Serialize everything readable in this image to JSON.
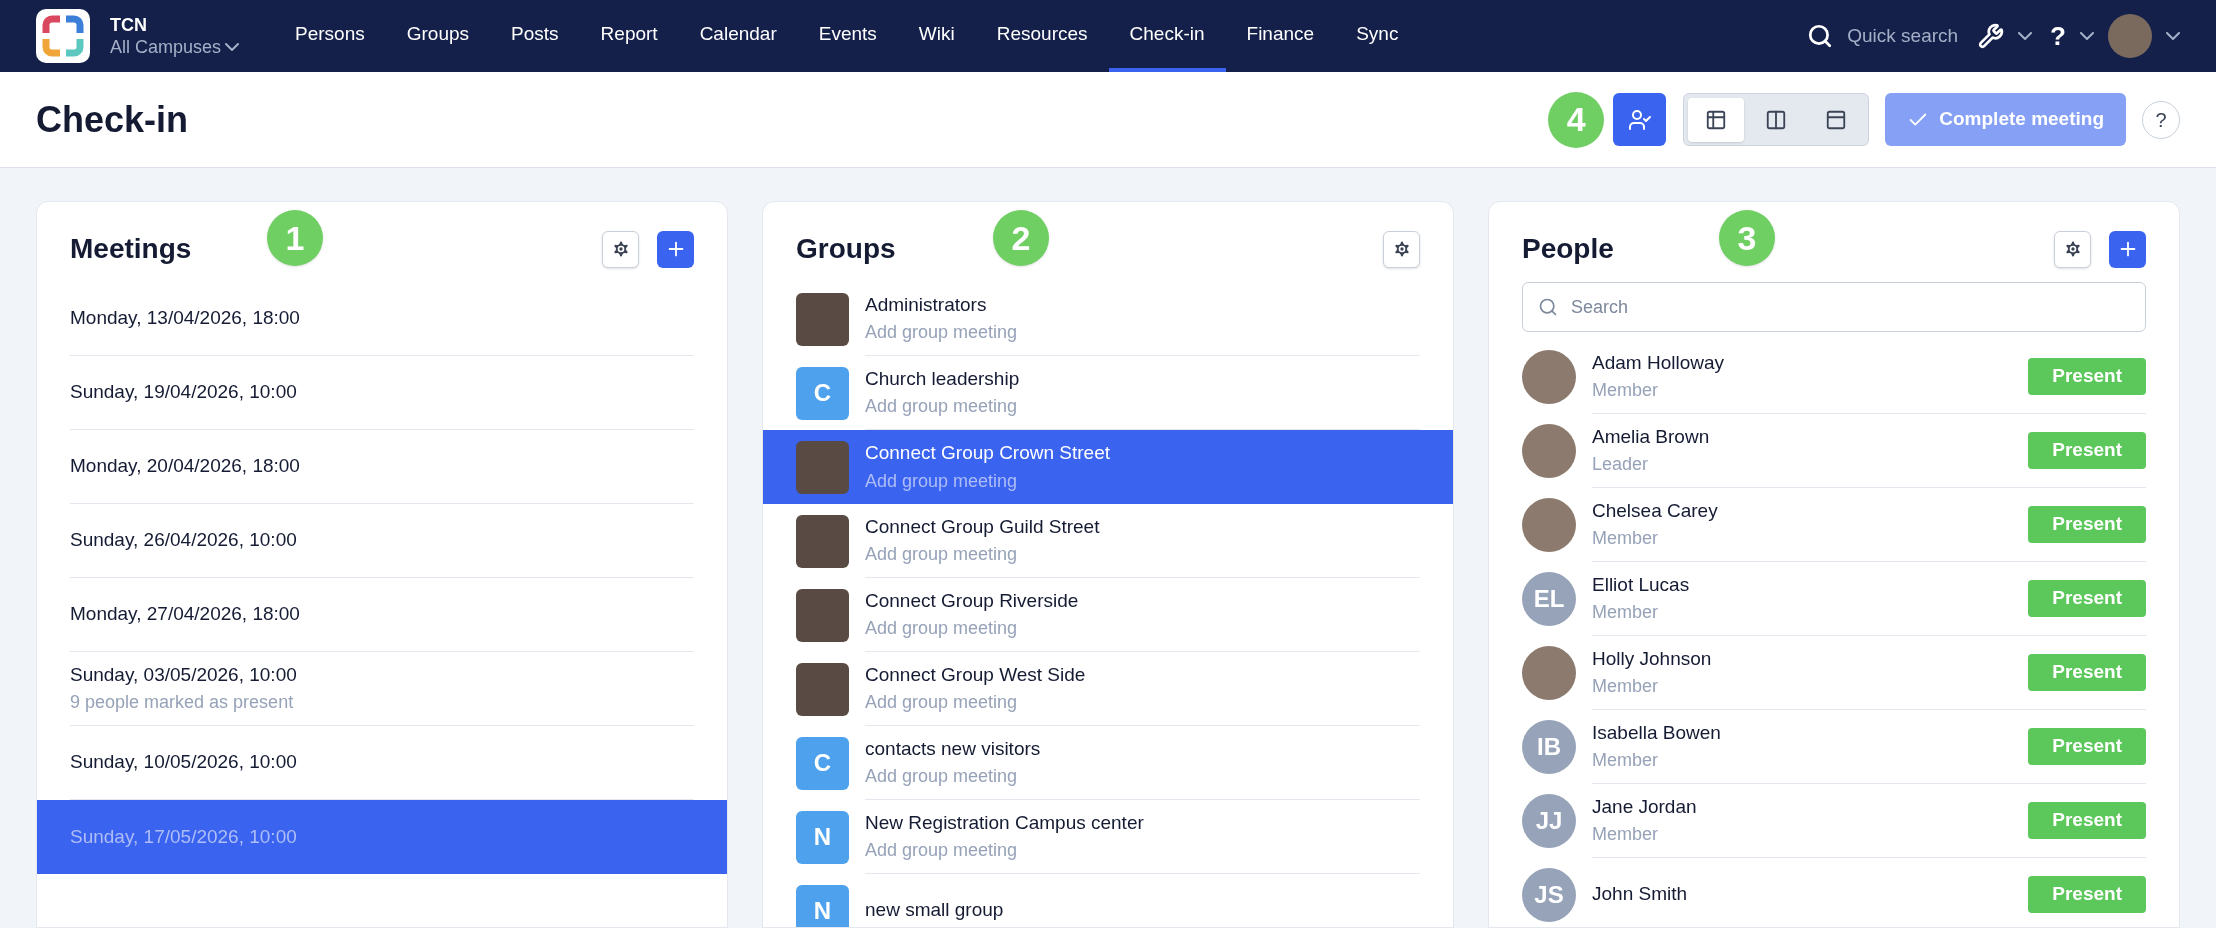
{
  "nav": {
    "brand": "TCN",
    "campus": "All Campuses",
    "items": [
      {
        "label": "Persons",
        "selected": false
      },
      {
        "label": "Groups",
        "selected": false
      },
      {
        "label": "Posts",
        "selected": false
      },
      {
        "label": "Report",
        "selected": false
      },
      {
        "label": "Calendar",
        "selected": false
      },
      {
        "label": "Events",
        "selected": false
      },
      {
        "label": "Wiki",
        "selected": false
      },
      {
        "label": "Resources",
        "selected": false
      },
      {
        "label": "Check-in",
        "selected": true
      },
      {
        "label": "Finance",
        "selected": false
      },
      {
        "label": "Sync",
        "selected": false
      }
    ],
    "quick_search": {
      "placeholder": "Quick search"
    }
  },
  "page": {
    "title": "Check-in",
    "step": "4",
    "view_modes": [
      {
        "kind": "table",
        "selected": true
      },
      {
        "kind": "columns",
        "selected": false
      },
      {
        "kind": "panel",
        "selected": false
      }
    ],
    "complete_button": {
      "label": "Complete meeting",
      "disabled": true
    },
    "help": "?"
  },
  "meetings": {
    "title": "Meetings",
    "step": "1",
    "items": [
      {
        "label": "Monday, 13/04/2026, 18:00",
        "selected": false
      },
      {
        "label": "Sunday, 19/04/2026, 10:00",
        "selected": false
      },
      {
        "label": "Monday, 20/04/2026, 18:00",
        "selected": false
      },
      {
        "label": "Sunday, 26/04/2026, 10:00",
        "selected": false
      },
      {
        "label": "Monday, 27/04/2026, 18:00",
        "selected": false
      },
      {
        "label": "Sunday, 03/05/2026, 10:00",
        "subtitle": "9 people marked as present",
        "selected": false
      },
      {
        "label": "Sunday, 10/05/2026, 10:00",
        "selected": false
      },
      {
        "label": "Sunday, 17/05/2026, 10:00",
        "selected": true
      }
    ]
  },
  "groups": {
    "title": "Groups",
    "step": "2",
    "items": [
      {
        "name": "Administrators",
        "subtitle": "Add group meeting",
        "avatar": {
          "kind": "photo"
        },
        "selected": false
      },
      {
        "name": "Church leadership",
        "subtitle": "Add group meeting",
        "avatar": {
          "kind": "letter",
          "letter": "C"
        },
        "selected": false
      },
      {
        "name": "Connect Group Crown Street",
        "subtitle": "Add group meeting",
        "avatar": {
          "kind": "photo"
        },
        "selected": true
      },
      {
        "name": "Connect Group Guild Street",
        "subtitle": "Add group meeting",
        "avatar": {
          "kind": "photo"
        },
        "selected": false
      },
      {
        "name": "Connect Group Riverside",
        "subtitle": "Add group meeting",
        "avatar": {
          "kind": "photo"
        },
        "selected": false
      },
      {
        "name": "Connect Group West Side",
        "subtitle": "Add group meeting",
        "avatar": {
          "kind": "photo"
        },
        "selected": false
      },
      {
        "name": "contacts new visitors",
        "subtitle": "Add group meeting",
        "avatar": {
          "kind": "letter",
          "letter": "C"
        },
        "selected": false
      },
      {
        "name": "New Registration Campus center",
        "subtitle": "Add group meeting",
        "avatar": {
          "kind": "letter",
          "letter": "N"
        },
        "selected": false
      },
      {
        "name": "new small group",
        "avatar": {
          "kind": "letter",
          "letter": "N"
        },
        "selected": false
      }
    ]
  },
  "people": {
    "title": "People",
    "step": "3",
    "search": {
      "placeholder": "Search"
    },
    "items": [
      {
        "name": "Adam Holloway",
        "role": "Member",
        "avatar": {
          "kind": "photo"
        },
        "button": "Present"
      },
      {
        "name": "Amelia Brown",
        "role": "Leader",
        "avatar": {
          "kind": "photo"
        },
        "button": "Present"
      },
      {
        "name": "Chelsea Carey",
        "role": "Member",
        "avatar": {
          "kind": "photo"
        },
        "button": "Present"
      },
      {
        "name": "Elliot Lucas",
        "role": "Member",
        "avatar": {
          "kind": "initials",
          "initials": "EL"
        },
        "button": "Present"
      },
      {
        "name": "Holly Johnson",
        "role": "Member",
        "avatar": {
          "kind": "photo"
        },
        "button": "Present"
      },
      {
        "name": "Isabella Bowen",
        "role": "Member",
        "avatar": {
          "kind": "initials",
          "initials": "IB"
        },
        "button": "Present"
      },
      {
        "name": "Jane Jordan",
        "role": "Member",
        "avatar": {
          "kind": "initials",
          "initials": "JJ"
        },
        "button": "Present"
      },
      {
        "name": "John Smith",
        "avatar": {
          "kind": "initials",
          "initials": "JS"
        },
        "button": "Present"
      }
    ]
  }
}
